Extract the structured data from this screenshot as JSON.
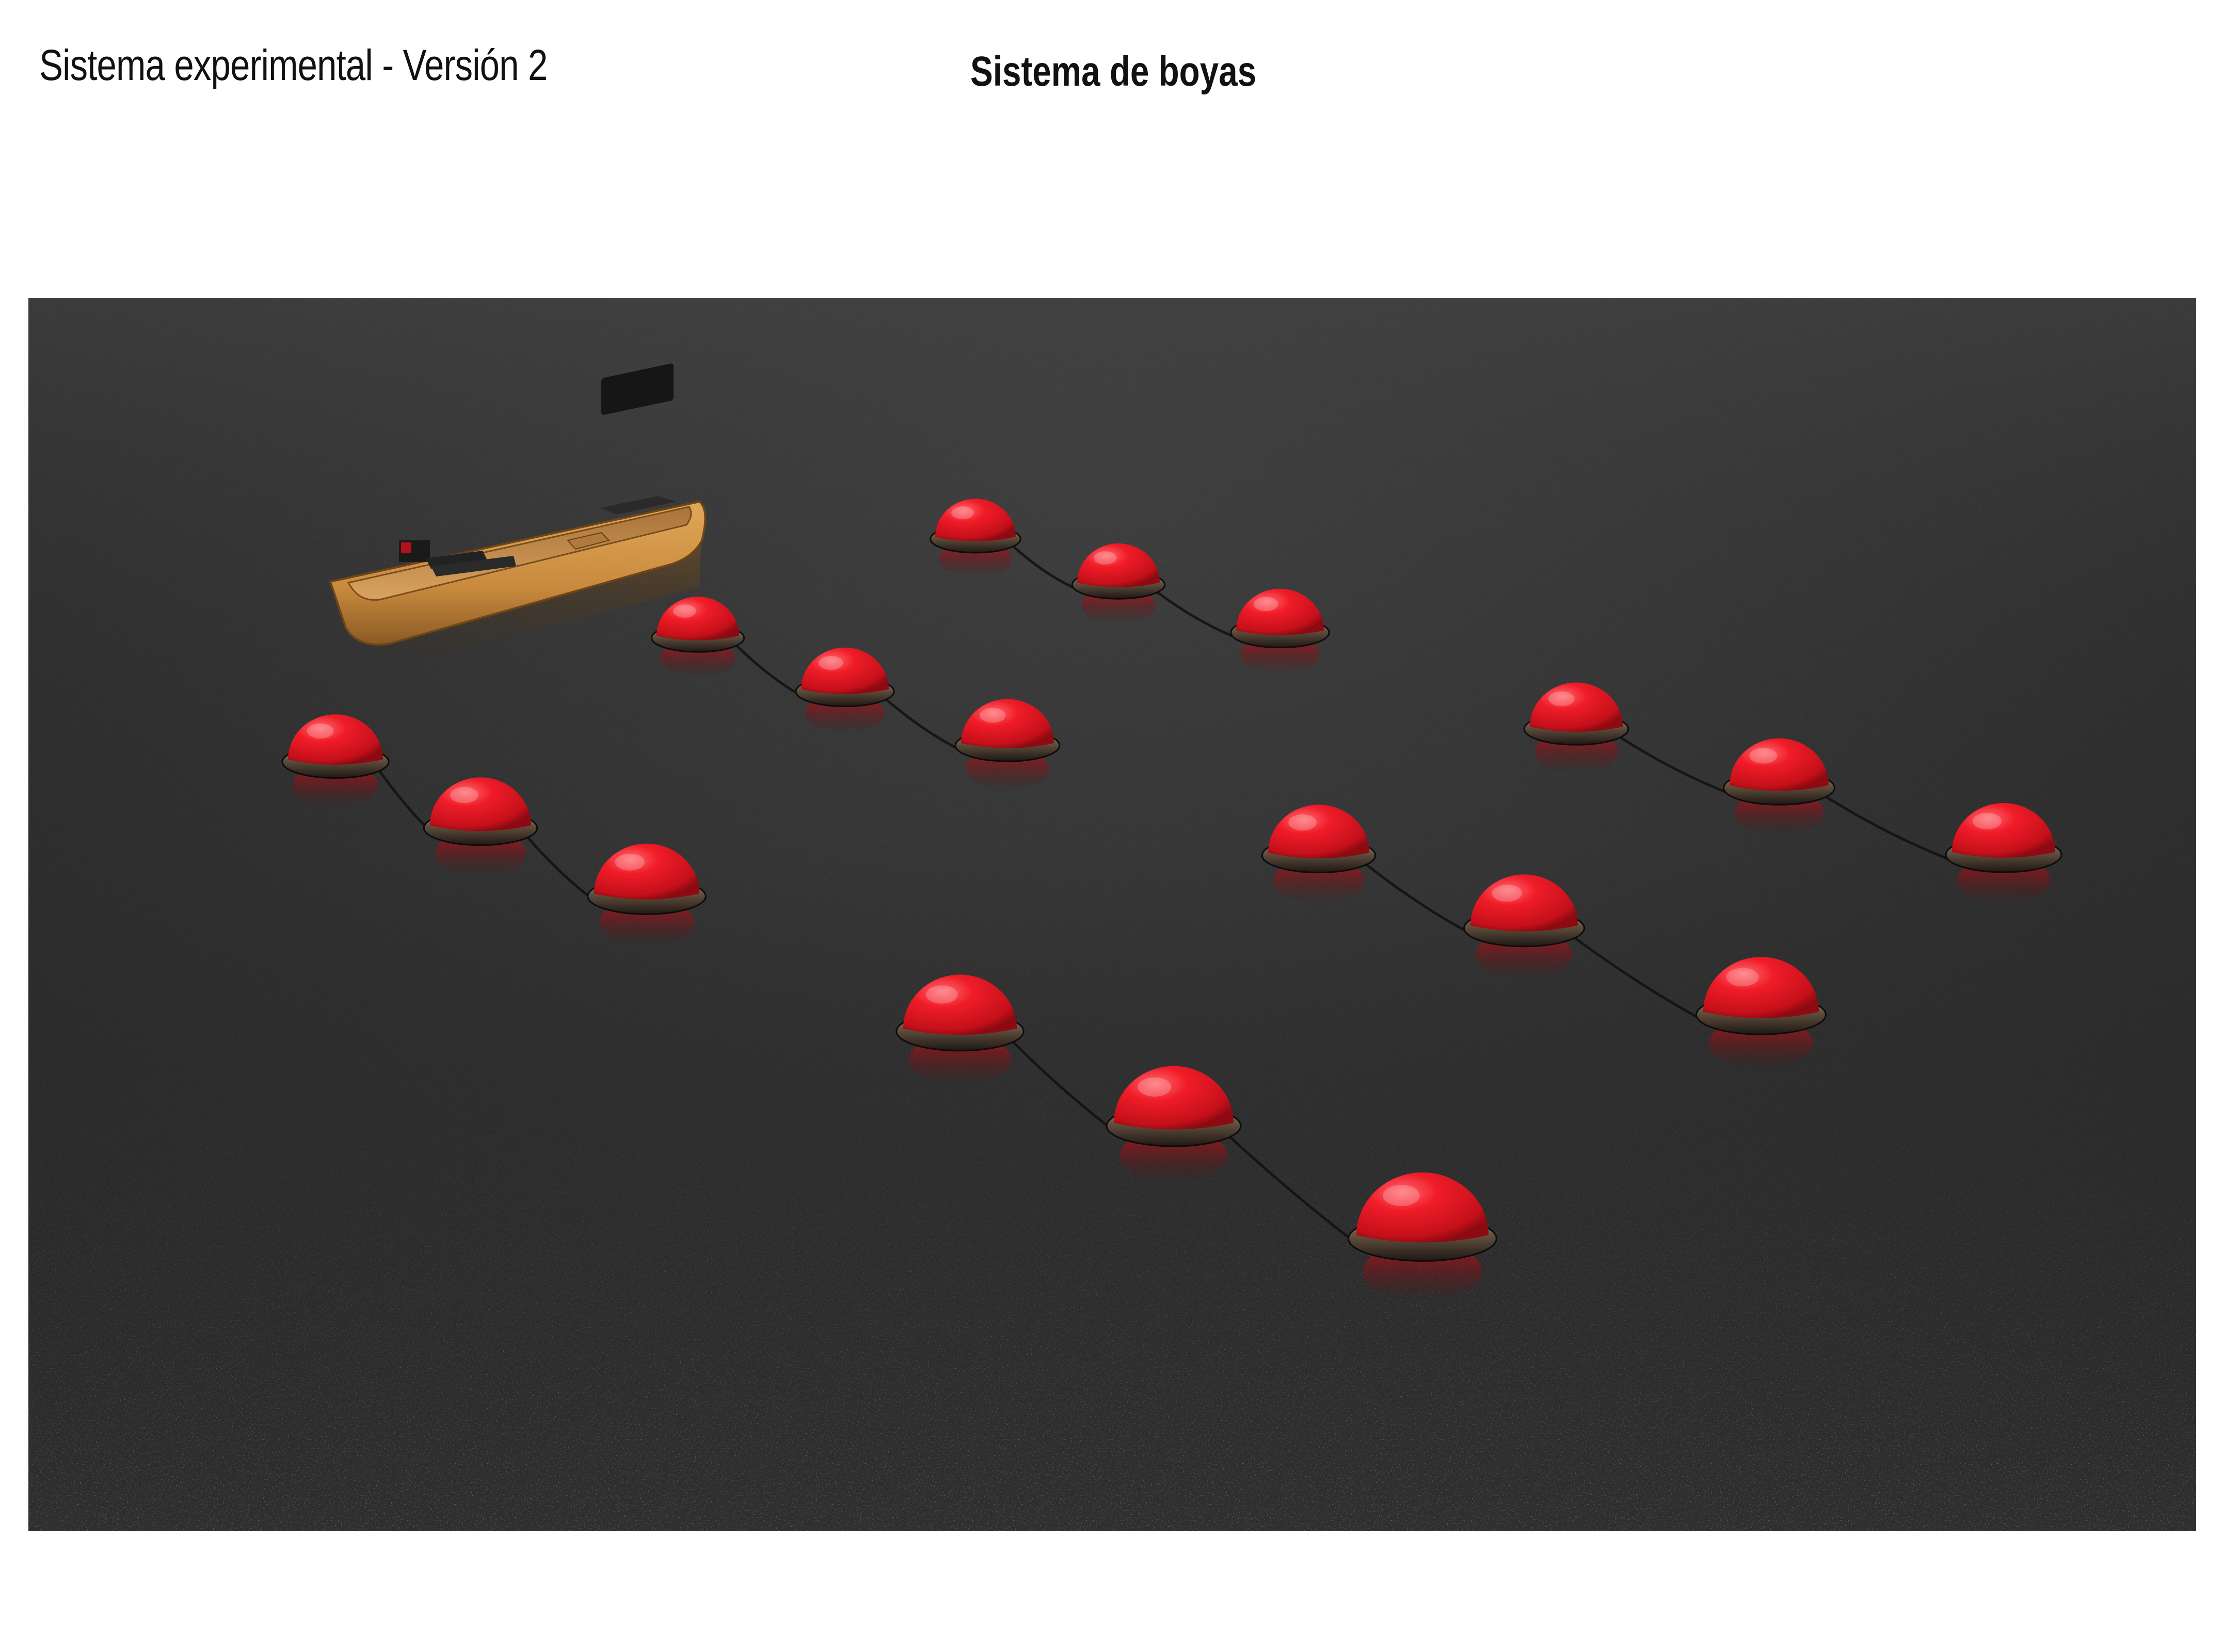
{
  "header": {
    "subtitle": "Sistema experimental - Versión 2",
    "title": "Sistema de boyas"
  },
  "scene": {
    "water_color": "#2b2b2b",
    "buoy_color": "#e8202a",
    "boat_color": "#c98a3e",
    "buoy_count": 18,
    "buoy_line_count": 6,
    "buoys_per_line": 3
  }
}
